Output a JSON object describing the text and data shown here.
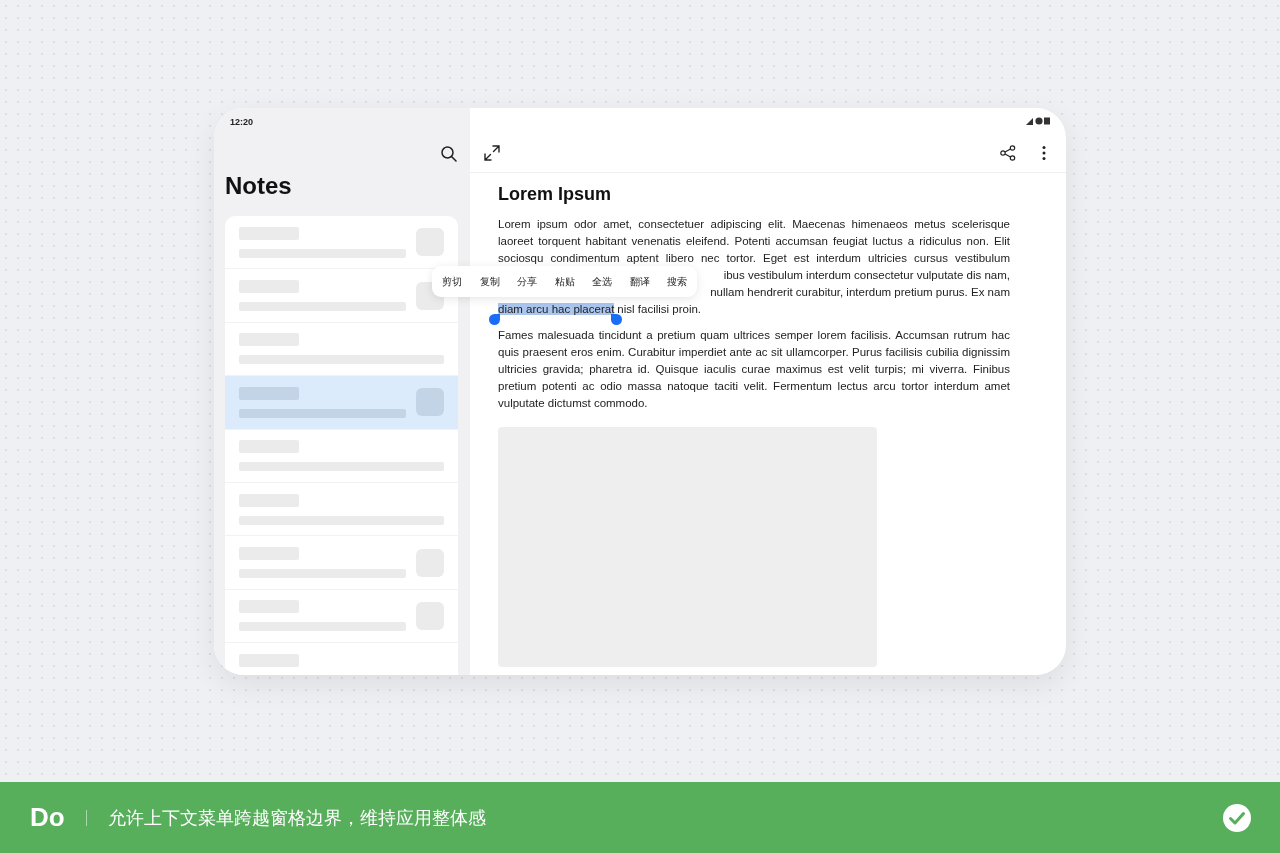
{
  "status_bar": {
    "time": "12:20"
  },
  "sidebar": {
    "title": "Notes",
    "notes": [
      {
        "thumbnail": true,
        "selected": false
      },
      {
        "thumbnail": true,
        "selected": false
      },
      {
        "thumbnail": false,
        "selected": false
      },
      {
        "thumbnail": true,
        "selected": true
      },
      {
        "thumbnail": false,
        "selected": false
      },
      {
        "thumbnail": false,
        "selected": false
      },
      {
        "thumbnail": true,
        "selected": false
      },
      {
        "thumbnail": true,
        "selected": false
      },
      {
        "selected": false
      }
    ]
  },
  "editor": {
    "title": "Lorem Ipsum",
    "paragraph_1": {
      "lines": [
        "Lorem ipsum odor amet, consectetuer adipiscing elit. Maecenas himenaeos metus scelerisque",
        "laoreet torquent habitant venenatis eleifend. Potenti accumsan feugiat luctus a ridiculus non. Elit",
        "sociosqu condimentum aptent libero nec tortor. Eget est interdum ultricies cursus vestibulum"
      ],
      "covered_lines": [
        "ibus vestibulum interdum consectetur vulputate dis nam,",
        "nullam hendrerit curabitur, interdum pretium purus. Ex nam"
      ],
      "selected_text": "diam arcu hac placerat",
      "rest": "nisl facilisi proin."
    },
    "paragraph_2": "Fames malesuada tincidunt a pretium quam ultrices semper lorem facilisis. Accumsan rutrum hac quis praesent eros enim. Curabitur imperdiet ante ac sit ullamcorper. Purus facilisis cubilia dignissim ultricies gravida; pharetra id. Quisque iaculis curae maximus est velit turpis; mi viverra. Finibus pretium potenti ac odio massa natoque taciti velit. Fermentum lectus arcu tortor interdum amet vulputate dictumst commodo.",
    "image": {
      "kind": "placeholder"
    }
  },
  "context_menu": [
    "剪切",
    "复制",
    "分享",
    "粘贴",
    "全选",
    "翻译",
    "搜索"
  ],
  "banner": {
    "label": "Do",
    "text": "允许上下文菜单跨越窗格边界，维持应用整体感"
  }
}
